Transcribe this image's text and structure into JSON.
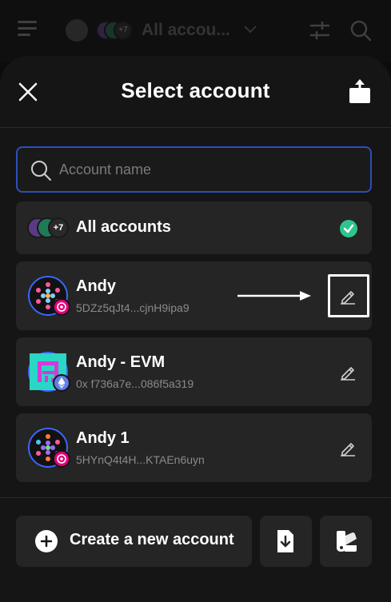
{
  "topbar": {
    "account_title": "All accou...",
    "count_badge": "+7"
  },
  "modal": {
    "title": "Select account"
  },
  "search": {
    "placeholder": "Account name"
  },
  "all_accounts": {
    "label": "All accounts",
    "count_badge": "+7"
  },
  "accounts": [
    {
      "name": "Andy",
      "address": "5DZz5qJt4...cjnH9ipa9",
      "network_icon": "polkadot-icon"
    },
    {
      "name": "Andy - EVM",
      "address": "0x f736a7e...086f5a319",
      "network_icon": "ethereum-icon"
    },
    {
      "name": "Andy 1",
      "address": "5HYnQ4t4H...KTAEn6uyn",
      "network_icon": "polkadot-icon"
    }
  ],
  "footer": {
    "create_label": "Create a new account"
  },
  "colors": {
    "accent_blue": "#3a66ff",
    "check_green": "#2fc48d",
    "polkadot_pink": "#e6007a",
    "ethereum_blue": "#627eea"
  }
}
